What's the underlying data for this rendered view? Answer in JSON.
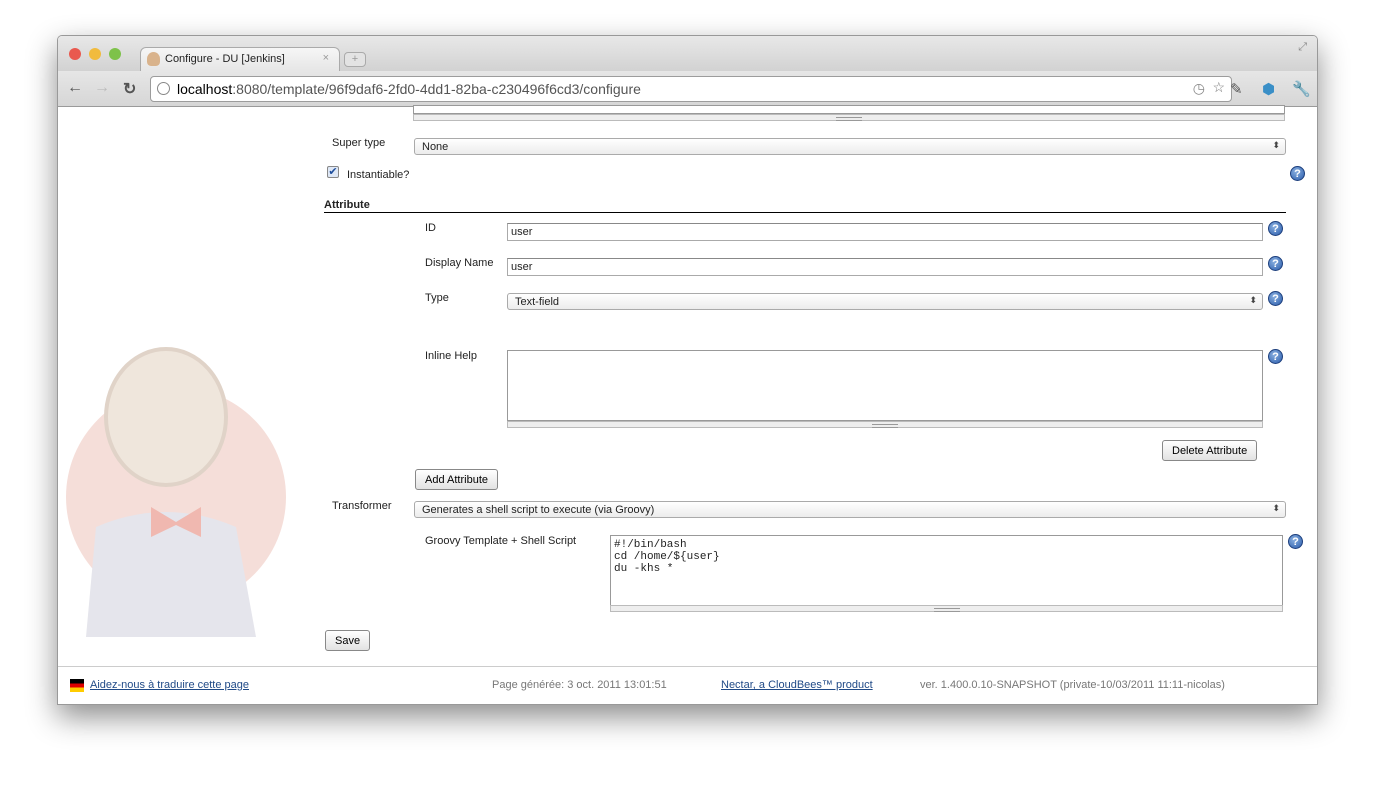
{
  "browser": {
    "tab_title": "Configure - DU [Jenkins]",
    "url_host": "localhost",
    "url_rest": ":8080/template/96f9daf6-2fd0-4dd1-82ba-c230496f6cd3/configure"
  },
  "form": {
    "super_type_label": "Super type",
    "super_type_value": "None",
    "instantiable_label": "Instantiable?",
    "instantiable_checked": true,
    "attribute_section": "Attribute",
    "id_label": "ID",
    "id_value": "user",
    "display_name_label": "Display Name",
    "display_name_value": "user",
    "type_label": "Type",
    "type_value": "Text-field",
    "inline_help_label": "Inline Help",
    "inline_help_value": "",
    "delete_attribute": "Delete Attribute",
    "add_attribute": "Add Attribute",
    "transformer_label": "Transformer",
    "transformer_value": "Generates a shell script to execute (via Groovy)",
    "script_label": "Groovy Template + Shell Script",
    "script_value": "#!/bin/bash\ncd /home/${user}\ndu -khs *",
    "save": "Save",
    "help": "?"
  },
  "footer": {
    "translate": "Aidez-nous à traduire cette page",
    "generated": "Page générée: 3 oct. 2011 13:01:51",
    "nectar": "Nectar, a CloudBees™ product",
    "version": "ver. 1.400.0.10-SNAPSHOT (private-10/03/2011 11:11-nicolas)"
  }
}
